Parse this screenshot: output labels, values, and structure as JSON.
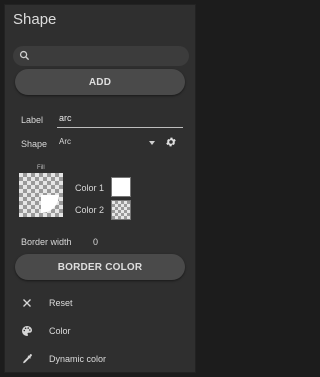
{
  "panel": {
    "title": "Shape"
  },
  "search": {
    "placeholder": "",
    "icon": "search-icon"
  },
  "buttons": {
    "add_label": "ADD",
    "border_color_label": "BORDER COLOR"
  },
  "label_field": {
    "caption": "Label",
    "value": "arc"
  },
  "shape_field": {
    "caption": "Shape",
    "selected": "Arc",
    "settings_icon": "gear-icon"
  },
  "fill": {
    "caption": "Fill"
  },
  "colors": {
    "color1_caption": "Color 1",
    "color1_value": "#ffffff",
    "color2_caption": "Color 2",
    "color2_value": "transparent"
  },
  "border_width": {
    "caption": "Border width",
    "value": "0"
  },
  "menu": [
    {
      "label": "Reset",
      "icon": "close-icon"
    },
    {
      "label": "Color",
      "icon": "palette-icon"
    },
    {
      "label": "Dynamic color",
      "icon": "eyedropper-icon"
    }
  ]
}
